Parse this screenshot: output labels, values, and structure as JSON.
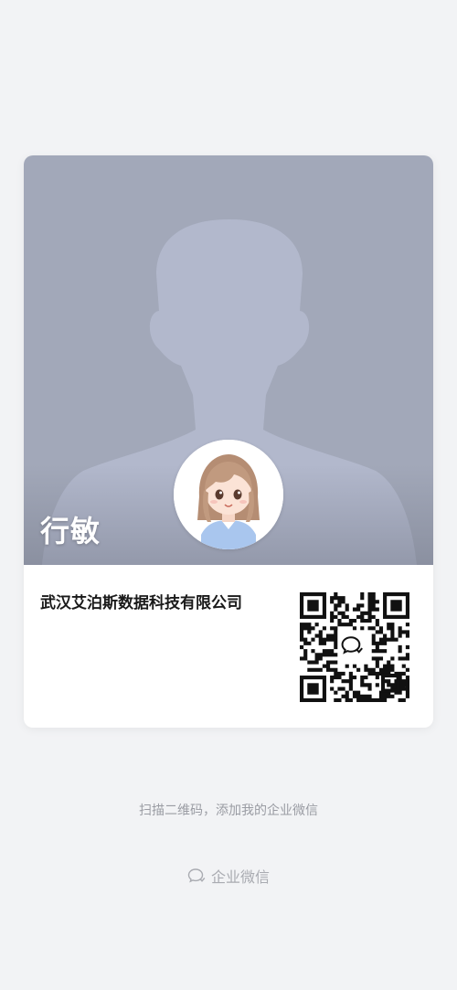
{
  "card": {
    "name": "行敏",
    "company": "武汉艾泊斯数据科技有限公司",
    "avatar_icon": "cartoon-girl-avatar",
    "qr_icon": "wecom-qr-code",
    "colors": {
      "cover": "#a2a8b9",
      "silhouette": "#b2b8cc"
    }
  },
  "footer": {
    "hint": "扫描二维码，添加我的企业微信",
    "brand_label": "企业微信",
    "brand_icon": "wecom-logo-icon"
  }
}
